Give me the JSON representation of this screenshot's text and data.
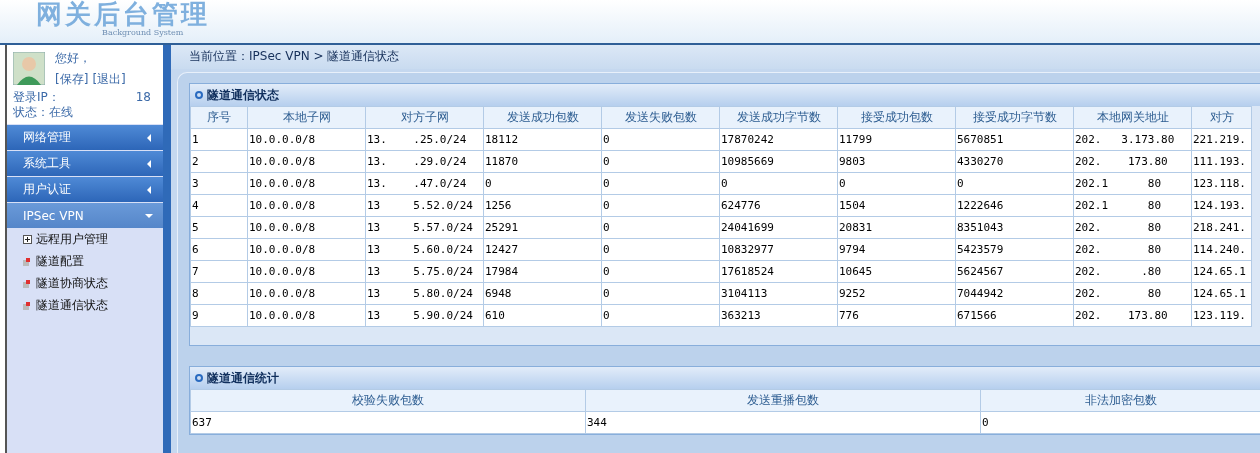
{
  "header": {
    "title": "网关后台管理",
    "subtitle": "Background System"
  },
  "user": {
    "greeting": "您好，",
    "actions": [
      "[保存]",
      "[退出]"
    ],
    "login_ip_label": "登录IP：",
    "login_ip_tail": "18",
    "status": "状态：在线"
  },
  "nav": [
    {
      "label": "网络管理",
      "expanded": false
    },
    {
      "label": "系统工具",
      "expanded": false
    },
    {
      "label": "用户认证",
      "expanded": false
    },
    {
      "label": "IPSec VPN",
      "expanded": true,
      "children": [
        {
          "label": "远程用户管理",
          "kind": "folder"
        },
        {
          "label": "隧道配置",
          "kind": "page"
        },
        {
          "label": "隧道协商状态",
          "kind": "page"
        },
        {
          "label": "隧道通信状态",
          "kind": "page"
        }
      ]
    }
  ],
  "breadcrumb": "当前位置：IPSec VPN > 隧道通信状态",
  "status_panel": {
    "title": "隧道通信状态",
    "columns": [
      "序号",
      "本地子网",
      "对方子网",
      "发送成功包数",
      "发送失败包数",
      "发送成功字节数",
      "接受成功包数",
      "接受成功字节数",
      "本地网关地址",
      "对方"
    ],
    "rows": [
      [
        "1",
        "10.0.0.0/8",
        "13.    .25.0/24",
        "18112",
        "0",
        "17870242",
        "11799",
        "5670851",
        "202.   3.173.80",
        "221.219."
      ],
      [
        "2",
        "10.0.0.0/8",
        "13.    .29.0/24",
        "11870",
        "0",
        "10985669",
        "9803",
        "4330270",
        "202.    173.80",
        "111.193."
      ],
      [
        "3",
        "10.0.0.0/8",
        "13.    .47.0/24",
        "0",
        "0",
        "0",
        "0",
        "0",
        "202.1      80",
        "123.118."
      ],
      [
        "4",
        "10.0.0.0/8",
        "13     5.52.0/24",
        "1256",
        "0",
        "624776",
        "1504",
        "1222646",
        "202.1      80",
        "124.193."
      ],
      [
        "5",
        "10.0.0.0/8",
        "13     5.57.0/24",
        "25291",
        "0",
        "24041699",
        "20831",
        "8351043",
        "202.       80",
        "218.241."
      ],
      [
        "6",
        "10.0.0.0/8",
        "13     5.60.0/24",
        "12427",
        "0",
        "10832977",
        "9794",
        "5423579",
        "202.       80",
        "114.240."
      ],
      [
        "7",
        "10.0.0.0/8",
        "13     5.75.0/24",
        "17984",
        "0",
        "17618524",
        "10645",
        "5624567",
        "202.      .80",
        "124.65.1"
      ],
      [
        "8",
        "10.0.0.0/8",
        "13     5.80.0/24",
        "6948",
        "0",
        "3104113",
        "9252",
        "7044942",
        "202.       80",
        "124.65.1"
      ],
      [
        "9",
        "10.0.0.0/8",
        "13     5.90.0/24",
        "610",
        "0",
        "363213",
        "776",
        "671566",
        "202.    173.80",
        "123.119."
      ]
    ]
  },
  "stats_panel": {
    "title": "隧道通信统计",
    "columns": [
      "校验失败包数",
      "发送重播包数",
      "非法加密包数"
    ],
    "rows": [
      [
        "637",
        "344",
        "0"
      ]
    ]
  }
}
